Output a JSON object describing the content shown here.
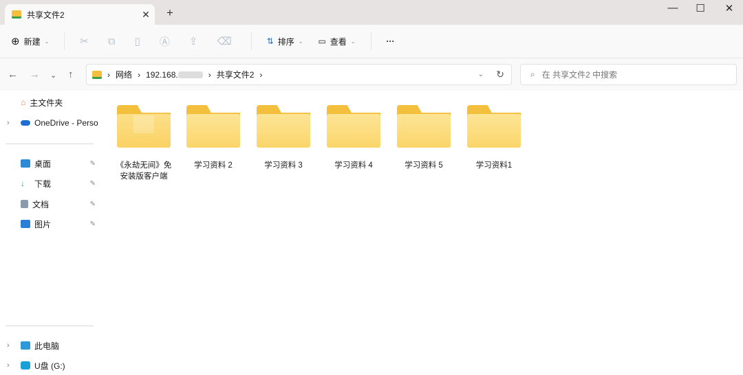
{
  "tab": {
    "title": "共享文件2",
    "close": "✕",
    "new": "+"
  },
  "window": {
    "min": "—",
    "max": "☐",
    "close": "✕"
  },
  "toolbar": {
    "new": "新建",
    "sort": "排序",
    "view": "查看",
    "more": "···"
  },
  "address": {
    "crumbs": [
      "网络",
      "192.168.",
      "共享文件2"
    ]
  },
  "search": {
    "placeholder": "在 共享文件2 中搜索"
  },
  "sidebar": {
    "home": "主文件夹",
    "onedrive": "OneDrive - Perso",
    "pinned": [
      "桌面",
      "下载",
      "文档",
      "图片"
    ],
    "pc": "此电脑",
    "usb": "U盘 (G:)"
  },
  "folders": [
    {
      "name": "《永劫无间》免安装版客户端",
      "line1": "《永劫无间》免",
      "line2": "安装版客户端"
    },
    {
      "name": "学习资料 2"
    },
    {
      "name": "学习资料 3"
    },
    {
      "name": "学习资料 4"
    },
    {
      "name": "学习资料 5"
    },
    {
      "name": "学习资料1"
    }
  ]
}
